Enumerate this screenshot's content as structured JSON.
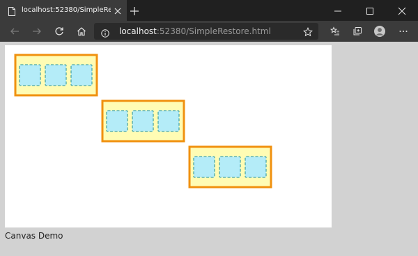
{
  "tab": {
    "title": "localhost:52380/SimpleRestore.html",
    "close_icon": "close-icon",
    "page_icon": "page-icon"
  },
  "window_controls": [
    "minimize-icon",
    "maximize-icon",
    "close-icon"
  ],
  "toolbar": {
    "url_host": "localhost",
    "url_rest": ":52380/SimpleRestore.html",
    "icons": [
      "back-icon",
      "forward-icon",
      "refresh-icon",
      "home-icon",
      "info-icon",
      "favorite-star-icon",
      "favorites-list-icon",
      "collections-icon",
      "profile-avatar-icon",
      "more-icon"
    ]
  },
  "canvas": {
    "groups": [
      {
        "squares": 3
      },
      {
        "squares": 3
      },
      {
        "squares": 3
      }
    ],
    "colors": {
      "group_fill": "#fffcb4",
      "group_border": "#f0910f",
      "square_fill": "#b4ecf8",
      "square_border": "#4aa6a6"
    }
  },
  "caption": "Canvas Demo"
}
